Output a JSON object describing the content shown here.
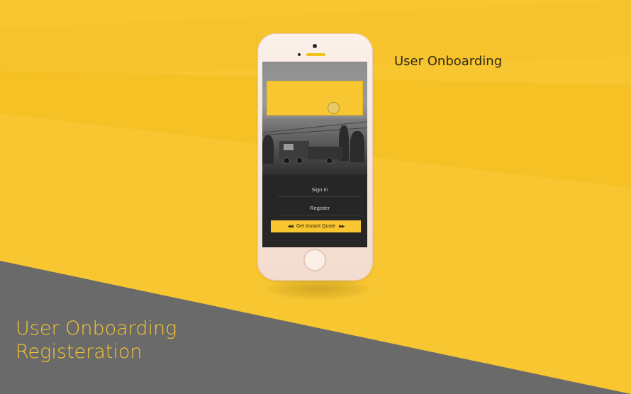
{
  "colors": {
    "accent": "#f8c630",
    "grey_band": "#6a6a6a",
    "dark_text": "#2e2a1e"
  },
  "header": {
    "title": "User Onboarding"
  },
  "caption": {
    "line1": "User Onboarding",
    "line2": "Registeration"
  },
  "app_screen": {
    "menu": {
      "sign_in": "Sign In",
      "register": "Register"
    },
    "cta": {
      "label": "Get Instant Quote",
      "left_icon": "chevrons-left-icon",
      "right_icon": "chevrons-right-icon"
    }
  }
}
